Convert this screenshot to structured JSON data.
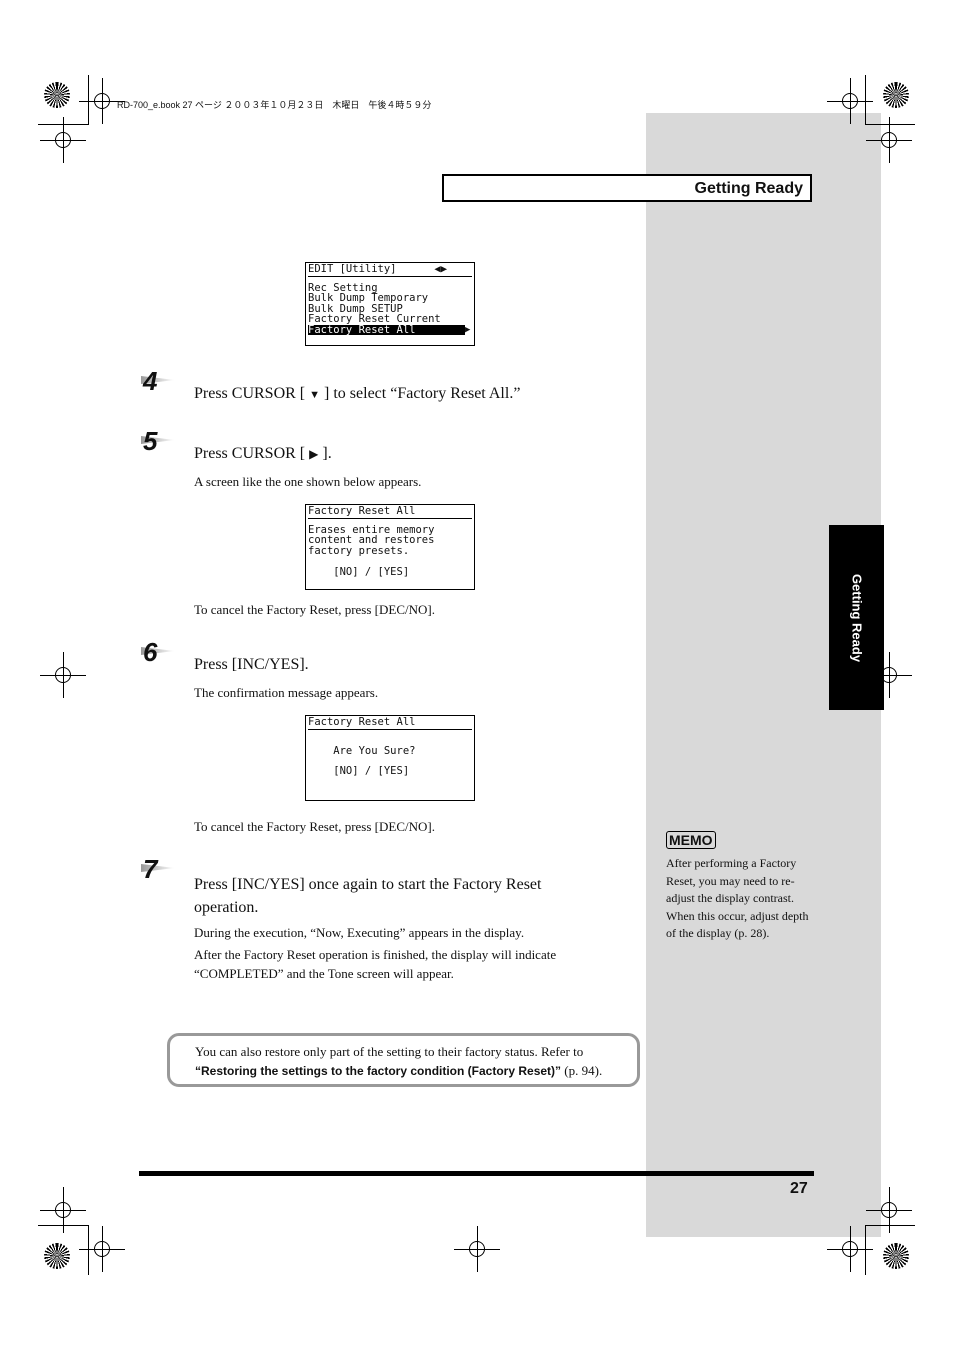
{
  "book_info": "RD-700_e.book 27 ページ ２００３年１０月２３日　木曜日　午後４時５９分",
  "header": {
    "title": "Getting Ready"
  },
  "side_tab": {
    "label": "Getting Ready"
  },
  "screens": [
    {
      "lines": [
        "EDIT [Utility]      ◀▶",
        "Rec Setting",
        "Bulk Dump Temporary",
        "Bulk Dump SETUP",
        "Factory Reset Current",
        "Factory Reset All"
      ],
      "highlight_arrow": "▶"
    },
    {
      "lines": [
        "Factory Reset All",
        "Erases entire memory",
        "content and restores",
        "factory presets.",
        "",
        "    [NO] / [YES]"
      ]
    },
    {
      "lines": [
        "Factory Reset All",
        "",
        "    Are You Sure?",
        "    [NO] / [YES]"
      ]
    }
  ],
  "steps": [
    {
      "number": "4",
      "text_before": "Press CURSOR [ ",
      "icon": "down-arrow",
      "text_after": " ] to select “Factory Reset All.”"
    },
    {
      "number": "5",
      "text_before": "Press CURSOR [ ",
      "icon": "right-arrow",
      "text_after": " ].",
      "sub": "A screen like the one shown below appears.",
      "after_screen": "To cancel the Factory Reset, press [DEC/NO]."
    },
    {
      "number": "6",
      "text": "Press [INC/YES].",
      "sub": "The confirmation message appears.",
      "after_screen": "To cancel the Factory Reset, press [DEC/NO]."
    },
    {
      "number": "7",
      "text": "Press [INC/YES] once again to start the Factory Reset operation.",
      "sub1": "During the execution, “Now, Executing” appears in the display.",
      "sub2": "After the Factory Reset operation is finished, the display will indicate “COMPLETED” and the Tone screen will appear."
    }
  ],
  "memo": {
    "label": "MEMO",
    "text": "After performing a Factory Reset, you may need to re-adjust the display contrast. When this occur, adjust depth of the display (p. 28)."
  },
  "note": {
    "text": "You can also restore only part of the setting to their factory status. Refer to",
    "link": "“Restoring the settings to the factory condition (Factory Reset)”",
    "ref": " (p. 94)."
  },
  "page_number": "27"
}
